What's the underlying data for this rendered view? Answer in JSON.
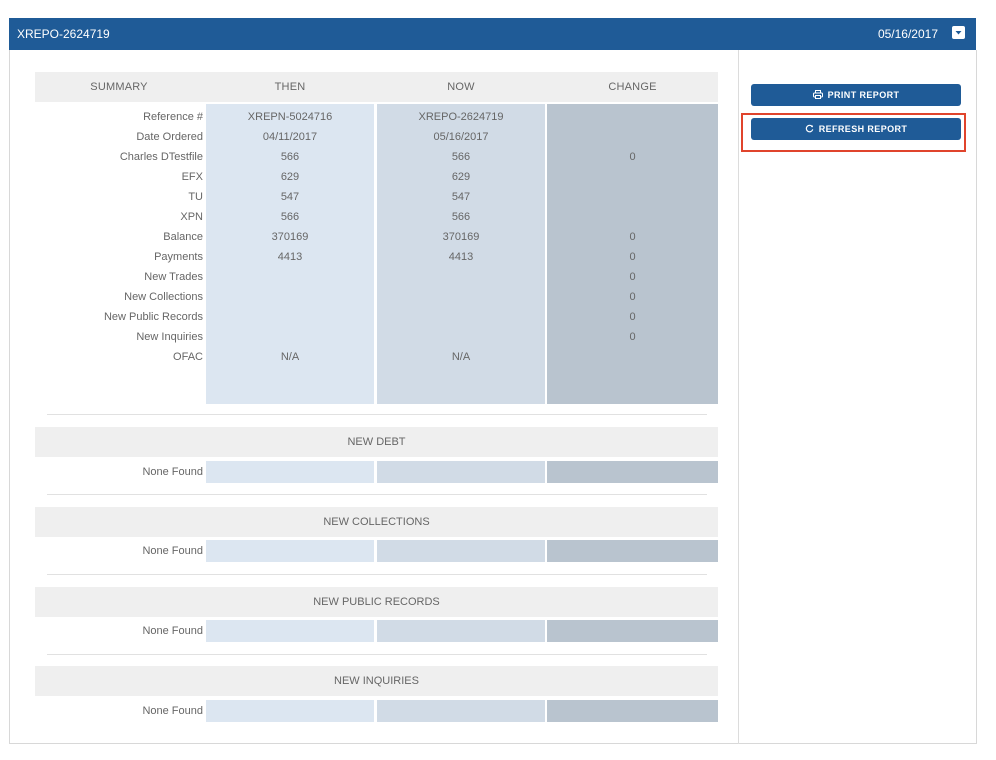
{
  "header": {
    "report_id": "XREPO-2624719",
    "date": "05/16/2017",
    "toggle_icon": "chevron-down-square-icon"
  },
  "summary": {
    "columns": [
      "SUMMARY",
      "THEN",
      "NOW",
      "CHANGE"
    ],
    "rows": [
      {
        "label": "Reference #",
        "then": "XREPN-5024716",
        "now": "XREPO-2624719",
        "change": ""
      },
      {
        "label": "Date Ordered",
        "then": "04/11/2017",
        "now": "05/16/2017",
        "change": ""
      },
      {
        "label": "Charles DTestfile",
        "then": "566",
        "now": "566",
        "change": "0"
      },
      {
        "label": "EFX",
        "then": "629",
        "now": "629",
        "change": ""
      },
      {
        "label": "TU",
        "then": "547",
        "now": "547",
        "change": ""
      },
      {
        "label": "XPN",
        "then": "566",
        "now": "566",
        "change": ""
      },
      {
        "label": "Balance",
        "then": "370169",
        "now": "370169",
        "change": "0"
      },
      {
        "label": "Payments",
        "then": "4413",
        "now": "4413",
        "change": "0"
      },
      {
        "label": "New Trades",
        "then": "",
        "now": "",
        "change": "0"
      },
      {
        "label": "New Collections",
        "then": "",
        "now": "",
        "change": "0"
      },
      {
        "label": "New Public Records",
        "then": "",
        "now": "",
        "change": "0"
      },
      {
        "label": "New Inquiries",
        "then": "",
        "now": "",
        "change": "0"
      },
      {
        "label": "OFAC",
        "then": "N/A",
        "now": "N/A",
        "change": ""
      }
    ]
  },
  "sections": [
    {
      "title": "NEW DEBT",
      "empty_label": "None Found"
    },
    {
      "title": "NEW COLLECTIONS",
      "empty_label": "None Found"
    },
    {
      "title": "NEW PUBLIC RECORDS",
      "empty_label": "None Found"
    },
    {
      "title": "NEW INQUIRIES",
      "empty_label": "None Found"
    }
  ],
  "actions": {
    "print_label": "PRINT REPORT",
    "print_icon": "printer-icon",
    "refresh_label": "REFRESH REPORT",
    "refresh_icon": "refresh-icon"
  },
  "colors": {
    "header_bg": "#1f5b97",
    "then_col": "#dce6f1",
    "now_col": "#d1dbe6",
    "change_col": "#b9c4cf",
    "highlight": "#e0442c"
  }
}
